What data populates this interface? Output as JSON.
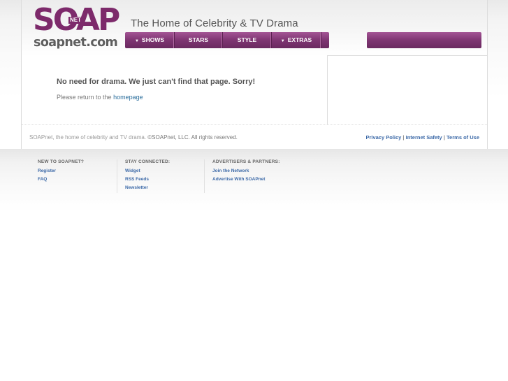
{
  "header": {
    "logo_text": "SOAP",
    "logo_badge": "NET",
    "logo_domain": "soapnet.com",
    "tagline": "The Home of Celebrity & TV Drama"
  },
  "nav": {
    "items": [
      {
        "label": "SHOWS",
        "has_dropdown": true
      },
      {
        "label": "STARS",
        "has_dropdown": false
      },
      {
        "label": "STYLE",
        "has_dropdown": false
      },
      {
        "label": "EXTRAS",
        "has_dropdown": true
      }
    ],
    "dropdown_glyph": "▼"
  },
  "content": {
    "heading": "No need for drama. We just can't find that page. Sorry!",
    "text_prefix": "Please return to the ",
    "homepage_link": "homepage"
  },
  "footer": {
    "copyright_part1": "SOAPnet, the home of celebrity and TV drama. ",
    "copyright_part2": "©SOAPnet, LLC. All rights reserved.",
    "links": [
      "Privacy Policy",
      "Internet Safety",
      "Terms of Use"
    ],
    "separator": "|",
    "columns": [
      {
        "heading": "NEW TO SOAPNET?",
        "links": [
          "Register",
          "FAQ"
        ]
      },
      {
        "heading": "STAY CONNECTED:",
        "links": [
          "Widget",
          "RSS Feeds",
          "Newsletter"
        ]
      },
      {
        "heading": "ADVERTISERS & PARTNERS:",
        "links": [
          "Join the Network",
          "Advertise With SOAPnet"
        ]
      }
    ]
  },
  "colors": {
    "brand_purple": "#7d2a6b",
    "link_blue": "#3d6aa8",
    "text_gray": "#555555"
  }
}
